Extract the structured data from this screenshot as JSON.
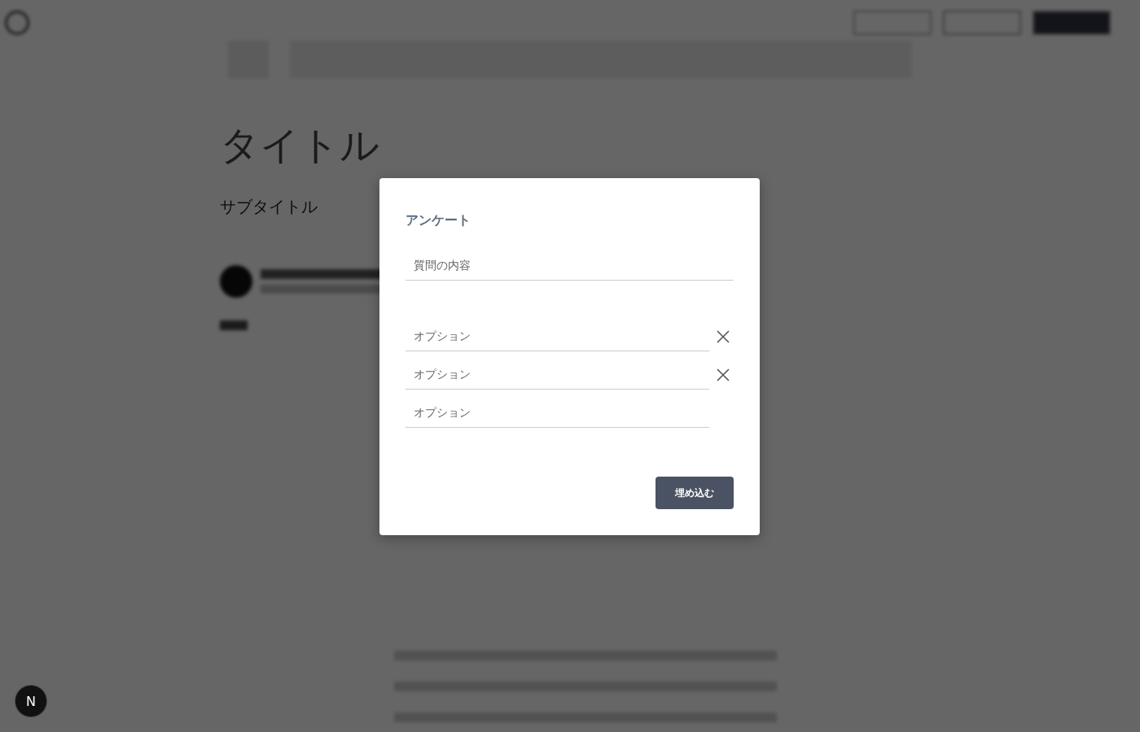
{
  "article": {
    "title": "タイトル",
    "subtitle": "サブタイトル"
  },
  "dialog": {
    "title": "アンケート",
    "question": {
      "placeholder": "質問の内容"
    },
    "options": [
      {
        "placeholder": "オプション",
        "removable": true
      },
      {
        "placeholder": "オプション",
        "removable": true
      },
      {
        "placeholder": "オプション",
        "removable": false
      }
    ],
    "submit": "埋め込む"
  },
  "dev_badge": {
    "label": "N"
  }
}
